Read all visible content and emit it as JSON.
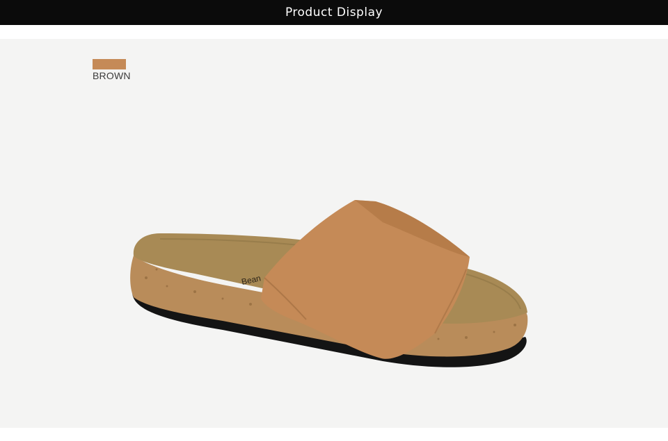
{
  "header": {
    "title": "Product Display"
  },
  "color_option": {
    "label": "BROWN",
    "swatch_color": "#c58a57"
  },
  "product": {
    "image_icon": "cork-slide-sandal-image",
    "insole_print": "Bean"
  }
}
